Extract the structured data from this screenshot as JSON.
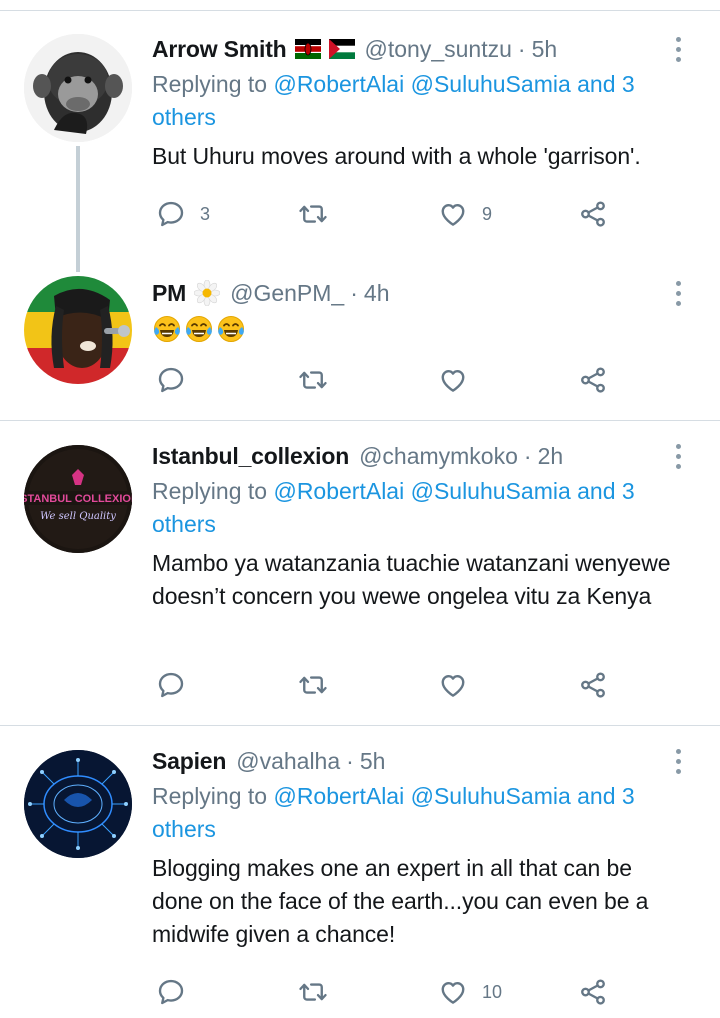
{
  "colors": {
    "link": "#1b95e0",
    "muted": "#657786",
    "text": "#14171a",
    "divider": "#d6dde3"
  },
  "tweets": [
    {
      "name": "Arrow Smith",
      "handle": "@tony_suntzu",
      "dot": "·",
      "time": "5h",
      "flags": [
        "kenya-flag",
        "palestine-flag"
      ],
      "replying_prefix": "Replying to ",
      "replying_to": "@RobertAlai @SuluhuSamia and 3 others",
      "text": "But Uhuru moves around with a whole 'garrison'.",
      "reply_count": "3",
      "retweet_count": "",
      "like_count": "9"
    },
    {
      "name": "PM",
      "name_emoji": "daisy-flower-icon",
      "handle": "@GenPM_",
      "dot": "·",
      "time": "4h",
      "emoji": [
        "tears-of-joy-emoji",
        "tears-of-joy-emoji",
        "tears-of-joy-emoji"
      ],
      "reply_count": "",
      "retweet_count": "",
      "like_count": ""
    },
    {
      "name": "Istanbul_collexion",
      "handle": "@chamymkoko",
      "dot": "·",
      "time": "2h",
      "avatar_text": "ISTANBUL COLLEXION",
      "avatar_tagline": "We sell Quality",
      "replying_prefix": "Replying to ",
      "replying_to": "@RobertAlai @SuluhuSamia and 3 others",
      "text": "Mambo ya watanzania tuachie watanzani wenyewe doesn’t concern you wewe ongelea vitu za Kenya",
      "reply_count": "",
      "retweet_count": "",
      "like_count": ""
    },
    {
      "name": "Sapien",
      "handle": "@vahalha",
      "dot": "·",
      "time": "5h",
      "replying_prefix": "Replying to ",
      "replying_to": "@RobertAlai @SuluhuSamia and 3 others",
      "text": "Blogging makes one an expert in all that can be done on the face of the earth...you can even be a midwife given a chance!",
      "reply_count": "",
      "retweet_count": "",
      "like_count": "10"
    }
  ]
}
